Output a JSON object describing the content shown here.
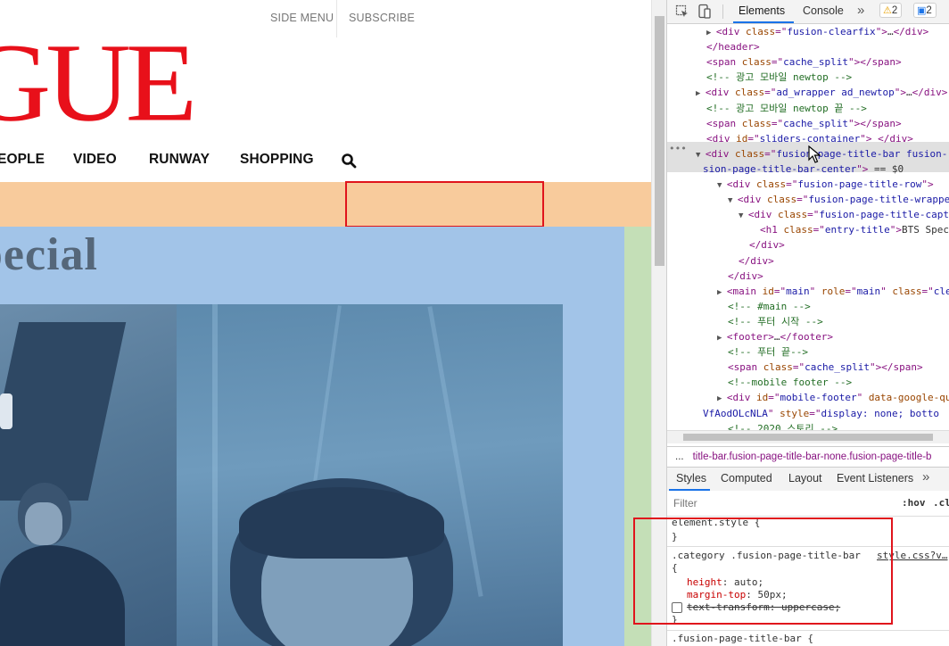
{
  "site": {
    "top_nav": [
      "SIDE MENU",
      "SUBSCRIBE"
    ],
    "logo_text": "GUE",
    "main_nav": [
      "EOPLE",
      "VIDEO",
      "RUNWAY",
      "SHOPPING"
    ],
    "page_title": "pecial"
  },
  "devtools": {
    "tabs": [
      "Elements",
      "Console"
    ],
    "more_tabs": "»",
    "warnings_count": "2",
    "messages_count": "2",
    "dom_lines": [
      {
        "indent": 4,
        "parts": [
          [
            "arrow",
            "▶"
          ],
          [
            "tag",
            "<div "
          ],
          [
            "attr",
            "class"
          ],
          [
            "tag",
            "=\""
          ],
          [
            "val",
            "fusion-clearfix"
          ],
          [
            "tag",
            "\">"
          ],
          [
            "plain",
            "…"
          ],
          [
            "tag",
            "</div>"
          ]
        ]
      },
      {
        "indent": 4,
        "parts": [
          [
            "tag",
            "</header>"
          ]
        ]
      },
      {
        "indent": 4,
        "parts": [
          [
            "tag",
            "<span "
          ],
          [
            "attr",
            "class"
          ],
          [
            "tag",
            "=\""
          ],
          [
            "val",
            "cache_split"
          ],
          [
            "tag",
            "\"></span>"
          ]
        ]
      },
      {
        "indent": 4,
        "parts": [
          [
            "cmt",
            "<!-- 광고 모바일 newtop -->"
          ]
        ]
      },
      {
        "indent": 3,
        "parts": [
          [
            "arrow",
            "▶"
          ],
          [
            "tag",
            "<div "
          ],
          [
            "attr",
            "class"
          ],
          [
            "tag",
            "=\""
          ],
          [
            "val",
            "ad_wrapper ad_newtop"
          ],
          [
            "tag",
            "\">"
          ],
          [
            "plain",
            "…"
          ],
          [
            "tag",
            "</div>"
          ]
        ]
      },
      {
        "indent": 4,
        "parts": [
          [
            "cmt",
            "<!-- 광고 모바일 newtop 끝 -->"
          ]
        ]
      },
      {
        "indent": 4,
        "parts": [
          [
            "tag",
            "<span "
          ],
          [
            "attr",
            "class"
          ],
          [
            "tag",
            "=\""
          ],
          [
            "val",
            "cache_split"
          ],
          [
            "tag",
            "\"></span>"
          ]
        ]
      },
      {
        "indent": 4,
        "parts": [
          [
            "tag",
            "<div "
          ],
          [
            "attr",
            "id"
          ],
          [
            "tag",
            "=\""
          ],
          [
            "val",
            "sliders-container"
          ],
          [
            "tag",
            "\"> </div>"
          ]
        ]
      },
      {
        "indent": 3,
        "parts": [
          [
            "arrow",
            "▼"
          ],
          [
            "tag",
            "<div "
          ],
          [
            "attr",
            "class"
          ],
          [
            "tag",
            "=\""
          ],
          [
            "val",
            "fusion-page-title-bar fusion-"
          ]
        ]
      },
      {
        "indent": 0,
        "parts": [
          [
            "val",
            "sion-page-title-bar-center"
          ],
          [
            "tag",
            "\">"
          ],
          [
            "plain",
            " == $0"
          ]
        ]
      },
      {
        "indent": 5,
        "parts": [
          [
            "arrow",
            "▼"
          ],
          [
            "tag",
            "<div "
          ],
          [
            "attr",
            "class"
          ],
          [
            "tag",
            "=\""
          ],
          [
            "val",
            "fusion-page-title-row"
          ],
          [
            "tag",
            "\">"
          ]
        ]
      },
      {
        "indent": 6,
        "parts": [
          [
            "arrow",
            "▼"
          ],
          [
            "tag",
            "<div "
          ],
          [
            "attr",
            "class"
          ],
          [
            "tag",
            "=\""
          ],
          [
            "val",
            "fusion-page-title-wrapper"
          ]
        ]
      },
      {
        "indent": 7,
        "parts": [
          [
            "arrow",
            "▼"
          ],
          [
            "tag",
            "<div "
          ],
          [
            "attr",
            "class"
          ],
          [
            "tag",
            "=\""
          ],
          [
            "val",
            "fusion-page-title-captio"
          ]
        ]
      },
      {
        "indent": 9,
        "parts": [
          [
            "tag",
            "<h1 "
          ],
          [
            "attr",
            "class"
          ],
          [
            "tag",
            "=\""
          ],
          [
            "val",
            "entry-title"
          ],
          [
            "tag",
            "\">"
          ],
          [
            "plain",
            "BTS Speci"
          ]
        ]
      },
      {
        "indent": 8,
        "parts": [
          [
            "tag",
            "</div>"
          ]
        ]
      },
      {
        "indent": 7,
        "parts": [
          [
            "tag",
            "</div>"
          ]
        ]
      },
      {
        "indent": 6,
        "parts": [
          [
            "tag",
            "</div>"
          ]
        ]
      },
      {
        "indent": 5,
        "parts": [
          [
            "arrow",
            "▶"
          ],
          [
            "tag",
            "<main "
          ],
          [
            "attr",
            "id"
          ],
          [
            "tag",
            "=\""
          ],
          [
            "val",
            "main"
          ],
          [
            "tag",
            "\" "
          ],
          [
            "attr",
            "role"
          ],
          [
            "tag",
            "=\""
          ],
          [
            "val",
            "main"
          ],
          [
            "tag",
            "\" "
          ],
          [
            "attr",
            "class"
          ],
          [
            "tag",
            "=\""
          ],
          [
            "val",
            "clea"
          ]
        ]
      },
      {
        "indent": 6,
        "parts": [
          [
            "cmt",
            "<!-- #main -->"
          ]
        ]
      },
      {
        "indent": 6,
        "parts": [
          [
            "cmt",
            "<!-- 푸터 시작 -->"
          ]
        ]
      },
      {
        "indent": 5,
        "parts": [
          [
            "arrow",
            "▶"
          ],
          [
            "tag",
            "<footer>"
          ],
          [
            "plain",
            "…"
          ],
          [
            "tag",
            "</footer>"
          ]
        ]
      },
      {
        "indent": 6,
        "parts": [
          [
            "cmt",
            "<!-- 푸터 끝-->"
          ]
        ]
      },
      {
        "indent": 6,
        "parts": [
          [
            "tag",
            "<span "
          ],
          [
            "attr",
            "class"
          ],
          [
            "tag",
            "=\""
          ],
          [
            "val",
            "cache_split"
          ],
          [
            "tag",
            "\"></span>"
          ]
        ]
      },
      {
        "indent": 6,
        "parts": [
          [
            "cmt",
            "<!--mobile footer -->"
          ]
        ]
      },
      {
        "indent": 5,
        "parts": [
          [
            "arrow",
            "▶"
          ],
          [
            "tag",
            "<div "
          ],
          [
            "attr",
            "id"
          ],
          [
            "tag",
            "=\""
          ],
          [
            "val",
            "mobile-footer"
          ],
          [
            "tag",
            "\" "
          ],
          [
            "attr",
            "data-google-que"
          ]
        ]
      },
      {
        "indent": 0,
        "parts": [
          [
            "val",
            "VfAodOLcNLA"
          ],
          [
            "tag",
            "\" "
          ],
          [
            "attr",
            "style"
          ],
          [
            "tag",
            "=\""
          ],
          [
            "val",
            "display: none; botto"
          ]
        ]
      },
      {
        "indent": 6,
        "parts": [
          [
            "cmt",
            "<!-- 2020 스토리 -->"
          ]
        ]
      }
    ],
    "breadcrumb": "title-bar.fusion-page-title-bar-none.fusion-page-title-b",
    "breadcrumb_prefix": "...",
    "style_tabs": [
      "Styles",
      "Computed",
      "Layout",
      "Event Listeners"
    ],
    "filter_placeholder": "Filter",
    "hov": ":hov",
    "cls": ".cl",
    "styles": {
      "element_style": "element.style {",
      "close": "}",
      "rule_selector": ".category .fusion-page-title-bar",
      "rule_source": "style.css?v…",
      "open": "{",
      "decl1_prop": "height",
      "decl1_val": " auto;",
      "decl2_prop": "margin-top",
      "decl2_val": " 50px;",
      "decl3": "text-transform: uppercase;",
      "next_selector": ".fusion-page-title-bar {"
    }
  }
}
